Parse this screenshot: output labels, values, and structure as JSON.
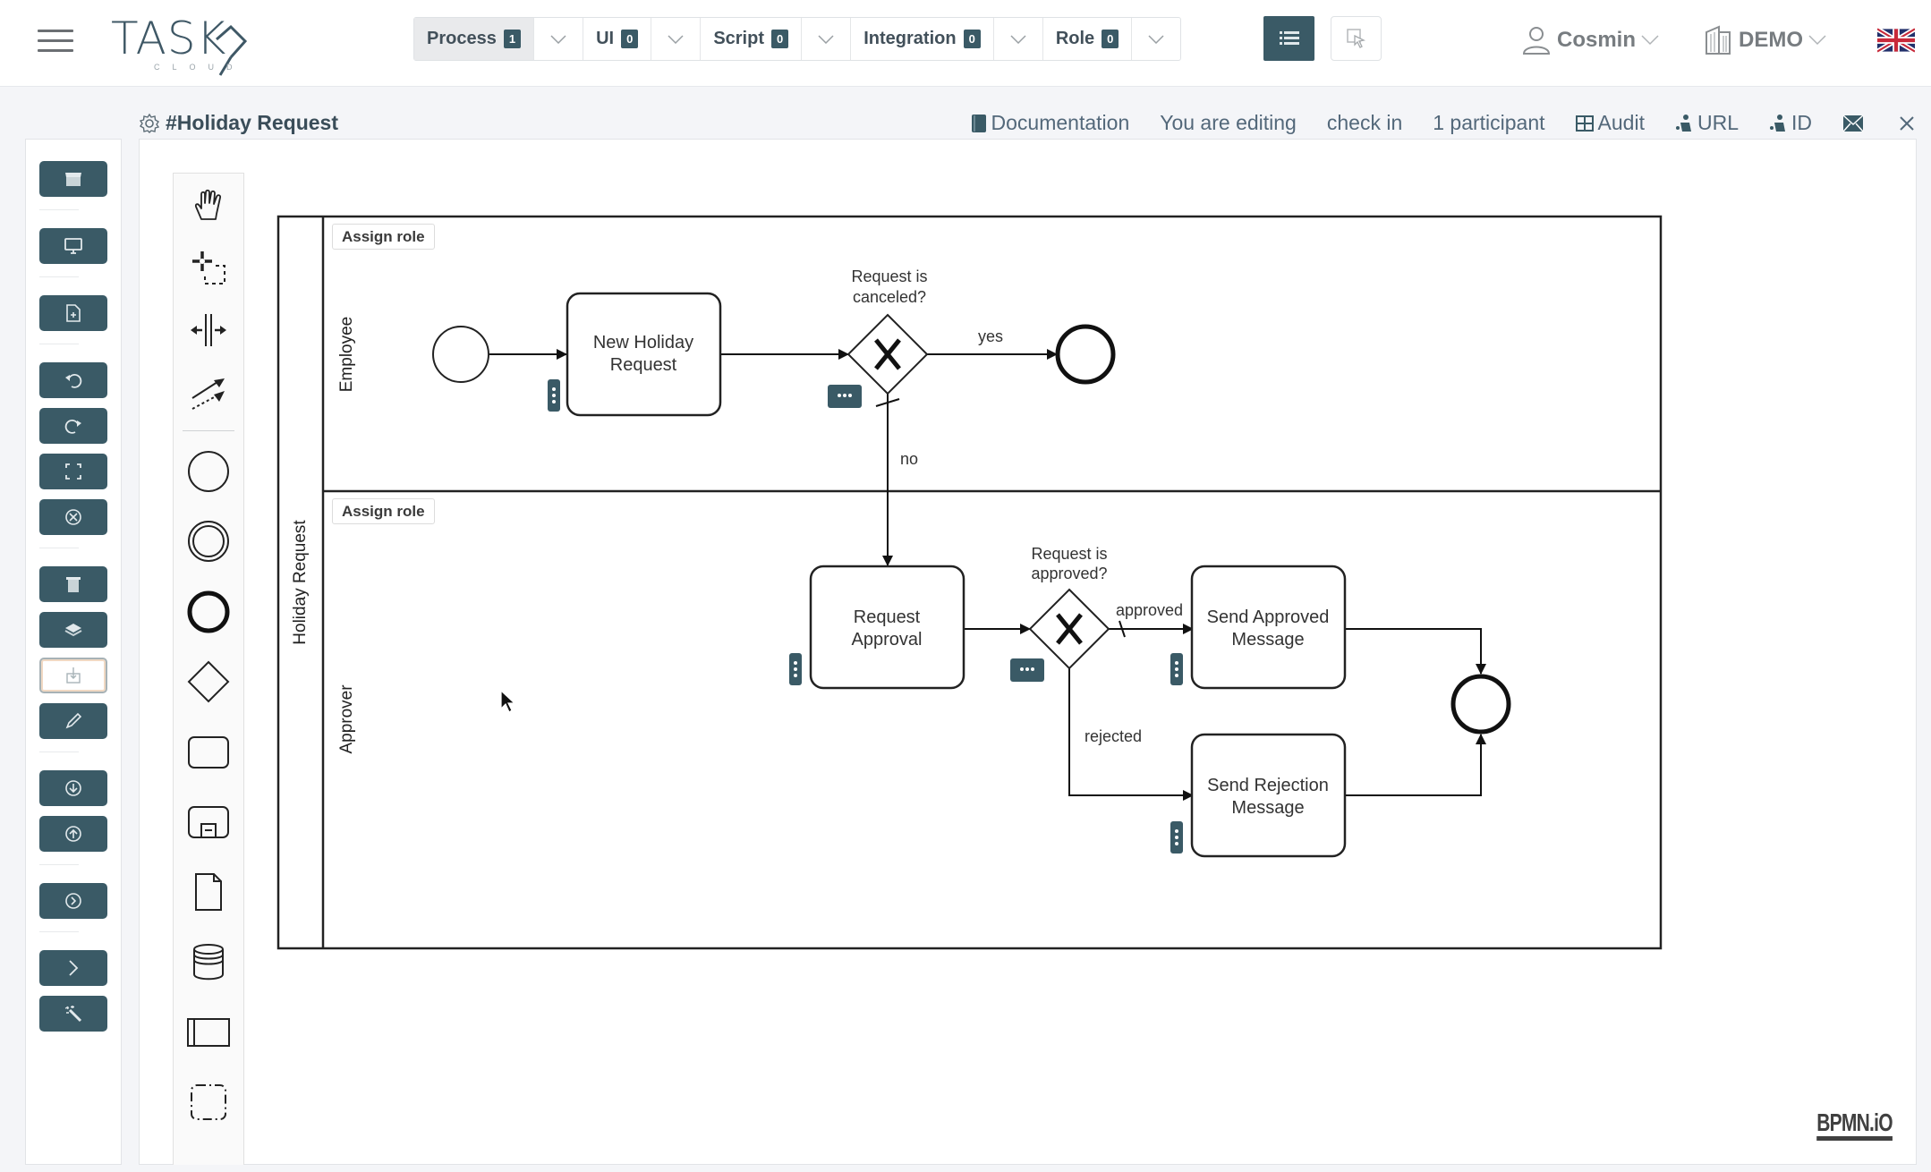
{
  "app": {
    "logo_text": "TASK",
    "logo_sub": "CLOUD"
  },
  "topbar": {
    "tabs": [
      {
        "label": "Process",
        "count": "1",
        "active": true
      },
      {
        "label": "UI",
        "count": "0",
        "active": false
      },
      {
        "label": "Script",
        "count": "0",
        "active": false
      },
      {
        "label": "Integration",
        "count": "0",
        "active": false
      },
      {
        "label": "Role",
        "count": "0",
        "active": false
      }
    ],
    "list_icon": "list-icon",
    "cursor_icon": "pointer-select-icon",
    "user": "Cosmin",
    "company": "DEMO",
    "language_icon": "uk-flag-icon"
  },
  "document": {
    "title": "#Holiday Request",
    "actions": {
      "documentation": "Documentation",
      "editing": "You are editing",
      "check_in": "check in",
      "participants": "1 participant",
      "audit": "Audit",
      "url": "URL",
      "id": "ID",
      "mail_icon": "envelope-icon",
      "close_icon": "close-icon"
    }
  },
  "sidebar": {
    "buttons": [
      "store-icon",
      "monitor-icon",
      "add-file-icon",
      "undo-icon",
      "redo-icon",
      "fullscreen-icon",
      "clear-icon",
      "trash-icon",
      "layers-icon",
      "import-icon",
      "edit-icon",
      "download-icon",
      "upload-icon",
      "run-icon",
      "next-icon",
      "magic-wand-icon"
    ]
  },
  "palette": {
    "tools": [
      "hand-tool",
      "lasso-tool",
      "space-tool",
      "connect-tool",
      "start-event",
      "intermediate-event",
      "end-event",
      "gateway",
      "task",
      "subprocess",
      "data-object",
      "data-store",
      "pool",
      "group"
    ]
  },
  "diagram": {
    "pool_label": "Holiday Request",
    "lanes": [
      {
        "label": "Employee",
        "assign_label": "Assign role"
      },
      {
        "label": "Approver",
        "assign_label": "Assign role"
      }
    ],
    "tasks": {
      "new_request": [
        "New Holiday",
        "Request"
      ],
      "request_approval": [
        "Request",
        "Approval"
      ],
      "send_approved": [
        "Send Approved",
        "Message"
      ],
      "send_rejection": [
        "Send Rejection",
        "Message"
      ]
    },
    "gateways": {
      "canceled": [
        "Request is",
        "canceled?"
      ],
      "approved": [
        "Request is",
        "approved?"
      ]
    },
    "flows": {
      "yes": "yes",
      "no": "no",
      "approved": "approved",
      "rejected": "rejected"
    },
    "watermark": "BPMN.iO"
  }
}
